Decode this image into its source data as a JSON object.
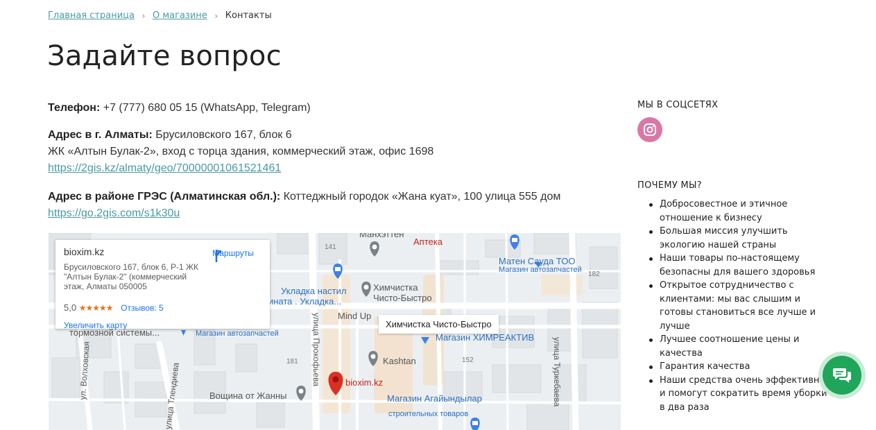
{
  "breadcrumb": {
    "home": "Главная страница",
    "about": "О магазине",
    "current": "Контакты"
  },
  "page_title": "Задайте вопрос",
  "contacts": {
    "phone_label": "Телефон:",
    "phone_value": "+7 (777) 680 05 15 (WhatsApp, Telegram)",
    "almaty_label": "Адрес в г. Алматы:",
    "almaty_line1": "Брусиловского 167, блок 6",
    "almaty_line2": "ЖК «Алтын Булак-2», вход с торца здания, коммерческий этаж, офис 1698",
    "almaty_link": "https://2gis.kz/almaty/geo/70000001061521461",
    "gres_label": "Адрес в районе ГРЭС (Алматинская обл.):",
    "gres_value": "Коттеджный городок «Жана куат», 100 улица 555 дом",
    "gres_link": "https://go.2gis.com/s1k30u"
  },
  "map": {
    "place_name": "bioxim.kz",
    "place_address": "Брусиловского 167, блок 6, Р-1 ЖК \"Алтын Булак-2\" (коммерческий этаж, Алматы 050005",
    "route_label": "Маршруты",
    "rating_value": "5,0",
    "rating_stars": "★★★★★",
    "reviews_label": "Отзывов: 5",
    "enlarge_label": "Увеличить карту",
    "tooltip": "Химчистка Чисто-Быстро",
    "labels": {
      "manhattan": "Манхэттен",
      "pharmacy": "Аптека",
      "num141": "141",
      "maten": "Матен Сауда ТОО",
      "auto_parts_store": "Магазин автозапчастей",
      "num182": "182",
      "ukladka1": "Укладка настил",
      "ukladka2": "мината . Укладка...",
      "himchistka1": "Химчистка",
      "himchistka2": "Чисто-Быстро",
      "mindup": "Mind Up",
      "street_turkebaeva": "улица Туркебаева",
      "street_prokofeva": "улица Прокофьева",
      "brake": "тормозной системы...",
      "auto_parts_store2": "Магазин автозапчастей",
      "himreaktiv": "Магазин ХИМРЕАКТИВ",
      "kashtan": "Kashtan",
      "num152": "152",
      "street_volkhovskaya": "ул. Волховская",
      "num181": "181",
      "bioxim_pin": "bioxim.kz",
      "voshchina": "Вощина от Жанны",
      "agaiyndylar": "Магазин Агайындылар",
      "building_goods": "строительных товаров",
      "street_tlendieva": "улица Тлендиева",
      "street_ul": "ул."
    },
    "colors": {
      "pin_red": "#d93025",
      "poi_blue": "#3f80e8",
      "poi_gray": "#7a8287",
      "label_blue": "#2b6fc2",
      "label_red": "#c5221f"
    }
  },
  "sidebar": {
    "social_title": "Мы в соцсетях",
    "instagram_color": "#d977a5",
    "why_title": "Почему мы?",
    "why_items": [
      "Добросовестное и этичное отношение к бизнесу",
      "Большая миссия улучшить экологию нашей страны",
      "Наши товары по-настоящему безопасны для вашего здоровья",
      "Открытое сотрудничество с клиентами: мы вас слышим и готовы становиться все лучше и лучше",
      "Лучшее соотношение цены и качества",
      "Гарантия качества",
      "Наши средства очень эффективны и помогут сократить время уборки в два раза"
    ]
  },
  "chat": {
    "color": "#1fa65a"
  }
}
